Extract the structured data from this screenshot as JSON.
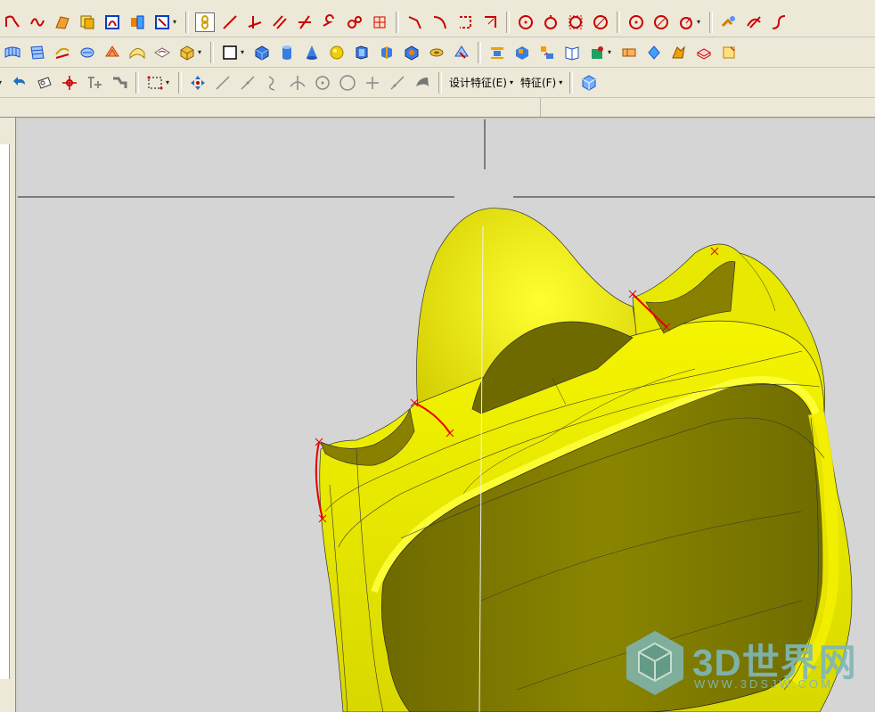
{
  "toolbar": {
    "row1_icons": [
      "sketch-curve-icon",
      "spline-icon",
      "surface-patch-icon",
      "offset-surface-icon",
      "blend-icon",
      "extend-icon",
      "trim-icon",
      "body-icon",
      "select-icon",
      "line-icon",
      "line-normal-icon",
      "parallel-line-icon",
      "angle-line-icon",
      "arc-line-icon",
      "curve-icon",
      "grid-plane-icon",
      "corner-icon",
      "fillet-corner-icon",
      "dimension-corner-icon",
      "edge-corner-icon",
      "circle-center-icon",
      "circle-3pt-icon",
      "circle-tan-icon",
      "circle-edge-icon",
      "point-circle-icon",
      "circle-diameter-icon",
      "circle-radius-icon",
      "curve-analysis-icon",
      "trim-curve-icon",
      "extend-curve-icon"
    ],
    "row2_icons": [
      "mesh-surface-icon",
      "ruled-surface-icon",
      "loft-surface-icon",
      "swept-surface-icon",
      "revolve-surface-icon",
      "offset-icon",
      "fill-surface-icon",
      "bounded-surface-icon",
      "rectangle-icon",
      "cube-icon",
      "cylinder-icon",
      "cone-icon",
      "sphere-icon",
      "extrude-icon",
      "revolve-icon",
      "boss-icon",
      "cut-icon",
      "hole-icon",
      "feature-pattern-icon",
      "mirror-icon",
      "book-icon",
      "positioning-icon",
      "box-icon",
      "fold-icon",
      "sheet-icon",
      "eraser-icon",
      "pad-icon"
    ],
    "row3_icons": [
      "undo-icon",
      "tape-icon",
      "origin-icon",
      "transform-icon",
      "stretch-icon",
      "selection-box-icon",
      "move-icon",
      "line-tool-icon",
      "line-tool2-icon",
      "curve-tool-icon",
      "cross-curve-icon",
      "circle-tool-icon",
      "circle-tool2-icon",
      "plus-tool-icon",
      "diagonal-tool-icon",
      "sweep-tool-icon"
    ],
    "menus": [
      {
        "label": "设计特征(E)",
        "arrow": "▾"
      },
      {
        "label": "特征(F)",
        "arrow": "▾"
      }
    ],
    "row3_trailing_icon": "cube-view-icon"
  },
  "watermark": {
    "title": "3D世界网",
    "subtitle": "WWW.3DSJW.COM"
  },
  "colors": {
    "model_yellow": "#f2f200",
    "model_shadow": "#7d7a00",
    "edge_highlight": "#e60000",
    "viewport_bg": "#d5d5d5"
  }
}
